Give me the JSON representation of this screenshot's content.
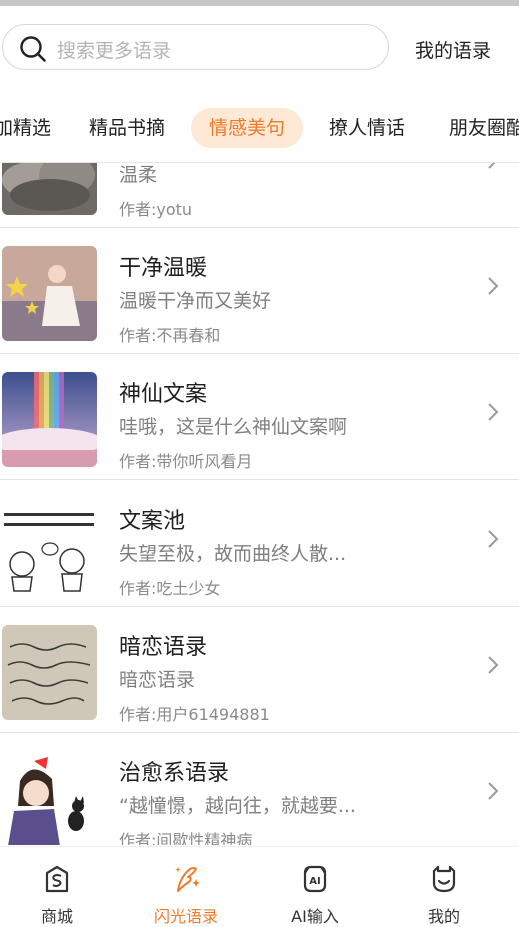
{
  "search": {
    "placeholder": "搜索更多语录",
    "my_quotes": "我的语录"
  },
  "tabs": [
    "加精选",
    "精品书摘",
    "情感美句",
    "撩人情话",
    "朋友圈酷"
  ],
  "active_tab": "情感美句",
  "items": [
    {
      "title": "",
      "desc": "温柔",
      "author": "作者:yotu",
      "thumb": "clouds-image"
    },
    {
      "title": "干净温暖",
      "desc": "温暖干净而又美好",
      "author": "作者:不再春和",
      "thumb": "girl-stars-illustration"
    },
    {
      "title": "神仙文案",
      "desc": "哇哦，这是什么神仙文案啊",
      "author": "作者:带你听风看月",
      "thumb": "rainbow-sky-image"
    },
    {
      "title": "文案池",
      "desc": "失望至极，故而曲终人散...",
      "author": "作者:吃土少女",
      "thumb": "comic-text-image"
    },
    {
      "title": "暗恋语录",
      "desc": "暗恋语录",
      "author": "作者:用户61494881",
      "thumb": "handwriting-note-image"
    },
    {
      "title": "治愈系语录",
      "desc": "“越憧憬，越向往，就越要...",
      "author": "作者:间歇性精神病",
      "thumb": "kiki-cat-illustration"
    }
  ],
  "bottom_nav": [
    {
      "label": "商城",
      "icon": "shop-icon"
    },
    {
      "label": "闪光语录",
      "icon": "quill-sparkle-icon",
      "active": true
    },
    {
      "label": "AI输入",
      "icon": "ai-keyboard-icon"
    },
    {
      "label": "我的",
      "icon": "profile-face-icon"
    }
  ],
  "colors": {
    "accent": "#f07a2a",
    "active_tab_bg": "#fde9d6"
  }
}
